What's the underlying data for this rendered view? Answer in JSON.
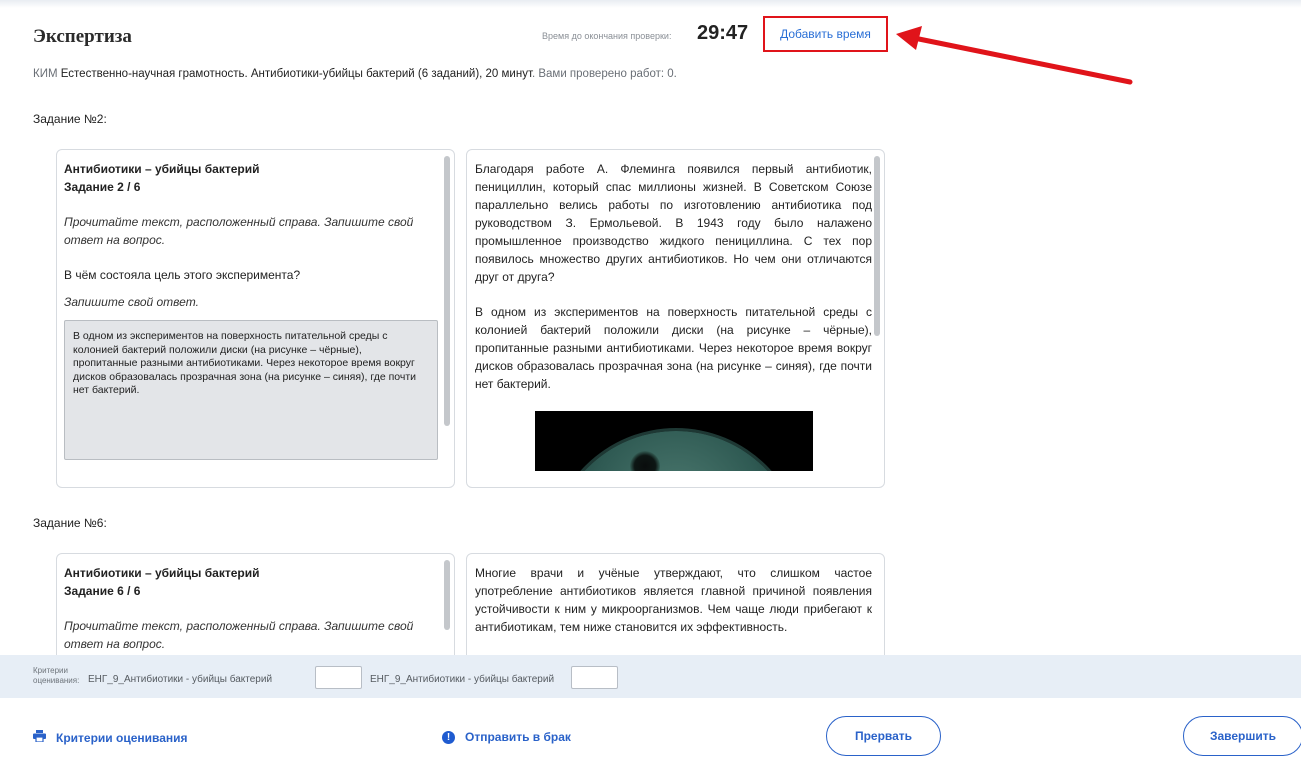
{
  "header": {
    "title": "Экспертиза",
    "timer_label": "Время до окончания проверки:",
    "timer_value": "29:47",
    "add_time_label": "Добавить время"
  },
  "kim": {
    "prefix": "КИМ",
    "description": "Естественно-научная грамотность. Антибиотики-убийцы бактерий (6 заданий), 20 минут",
    "checked_label": ". Вами проверено работ: 0."
  },
  "tasks": [
    {
      "heading": "Задание №2:",
      "left": {
        "title": "Антибиотики – убийцы бактерий",
        "subtitle": "Задание 2 / 6",
        "instruction": "Прочитайте текст, расположенный справа. Запишите свой ответ на вопрос.",
        "question": "В чём состояла цель этого эксперимента?",
        "answer_label": "Запишите свой ответ.",
        "answer_text": "В одном из экспериментов на поверхность питательной среды с колонией бактерий положили диски (на рисунке – чёрные), пропитанные разными антибиотиками. Через некоторое время вокруг дисков образовалась прозрачная зона (на рисунке – синяя), где почти нет бактерий."
      },
      "right": {
        "paragraph1": "Благодаря работе А. Флеминга появился первый антибиотик, пенициллин, который спас миллионы жизней. В Советском Союзе параллельно велись работы по изготовлению антибиотика под руководством З. Ермольевой. В 1943 году было налажено промышленное производство жидкого пенициллина. С тех пор появилось множество других антибиотиков. Но чем они отличаются друг от друга?",
        "paragraph2": "В одном из экспериментов на поверхность питательной среды с колонией бактерий положили диски (на рисунке – чёрные), пропитанные разными антибиотиками. Через некоторое время вокруг дисков образовалась прозрачная зона (на рисунке – синяя), где почти нет бактерий."
      }
    },
    {
      "heading": "Задание №6:",
      "left": {
        "title": "Антибиотики – убийцы бактерий",
        "subtitle": "Задание 6 / 6",
        "instruction": "Прочитайте текст, расположенный справа. Запишите свой ответ на вопрос."
      },
      "right": {
        "paragraph1": "Многие врачи и учёные утверждают, что слишком частое употребление антибиотиков является главной причиной появления устойчивости к ним у микроорганизмов. Чем чаще люди прибегают к антибиотикам, тем ниже становится их эффективность."
      }
    }
  ],
  "criteria": {
    "label": "Критерии оценивания:",
    "items": [
      {
        "name": "ЕНГ_9_Антибиотики - убийцы бактерий",
        "value": ""
      },
      {
        "name": "ЕНГ_9_Антибиотики - убийцы бактерий",
        "value": ""
      }
    ]
  },
  "footer": {
    "criteria_link": "Критерии оценивания",
    "reject_link": "Отправить в брак",
    "interrupt_button": "Прервать",
    "finish_button": "Завершить"
  },
  "icons": {
    "printer": "printer-icon",
    "info": "info-icon",
    "arrow": "red-arrow-annotation"
  },
  "colors": {
    "accent": "#2a62c9",
    "annotation_red": "#e0141a",
    "criteria_bg": "#e7eef6"
  }
}
